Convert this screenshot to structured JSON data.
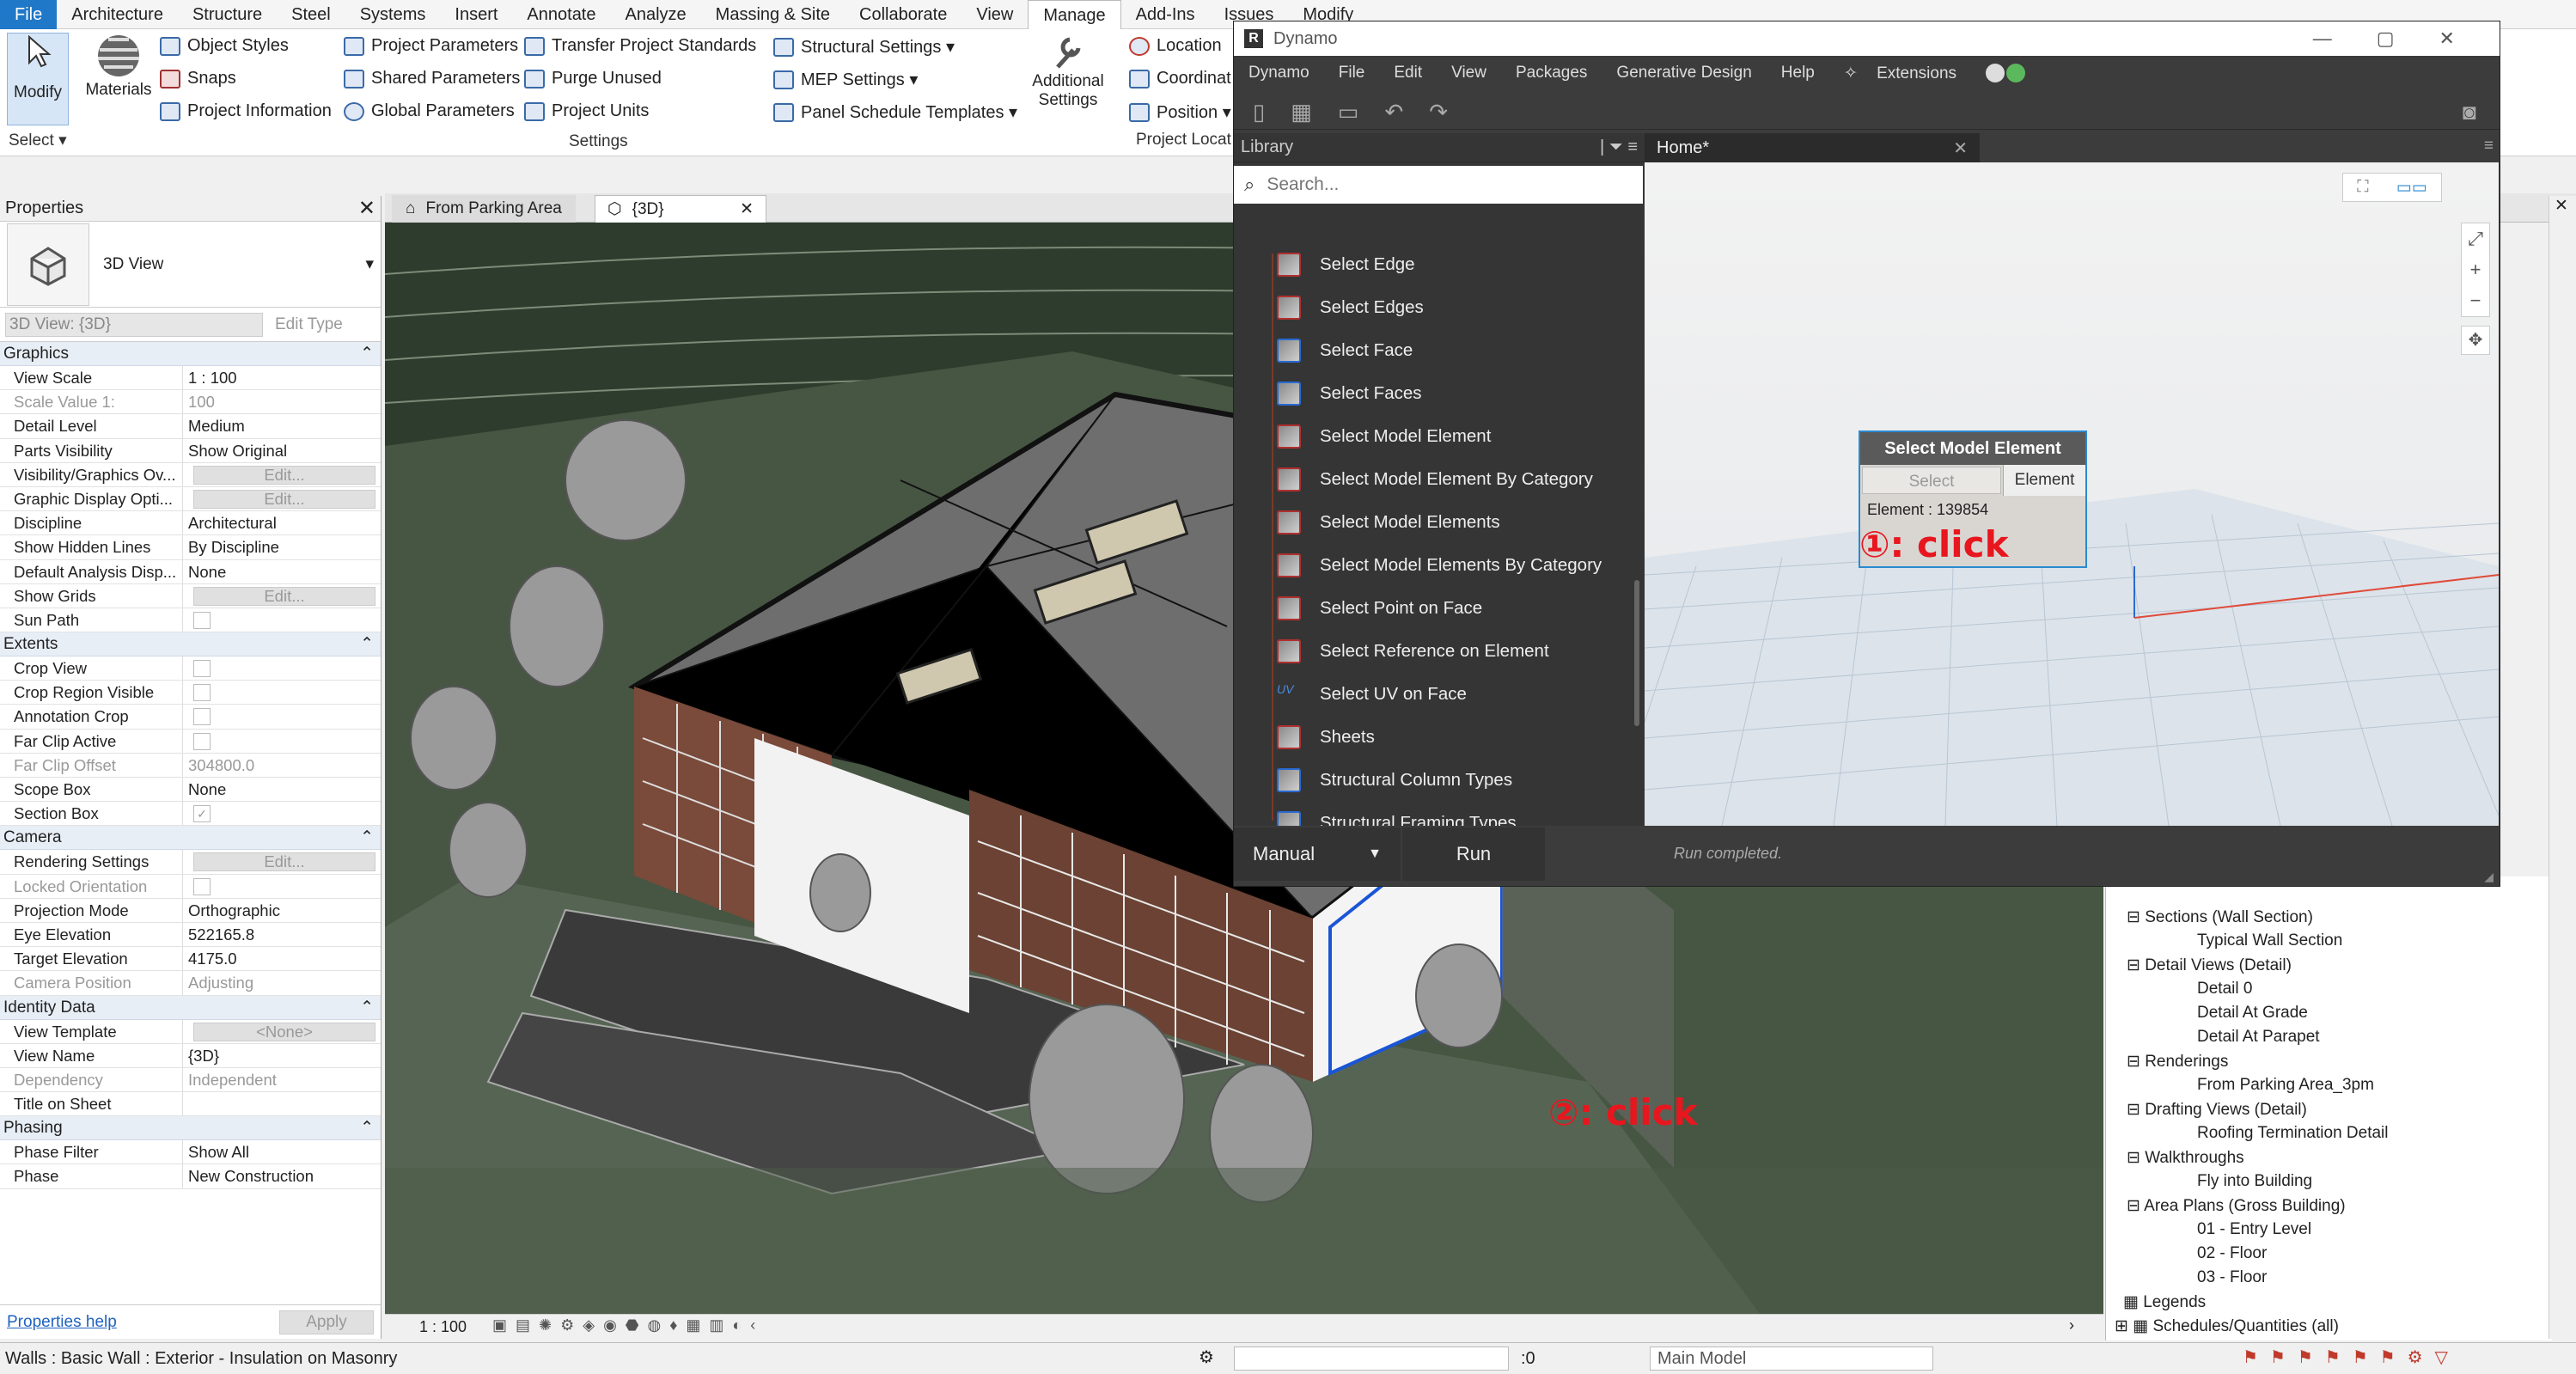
{
  "ribbon": {
    "tabs": [
      "File",
      "Architecture",
      "Structure",
      "Steel",
      "Systems",
      "Insert",
      "Annotate",
      "Analyze",
      "Massing & Site",
      "Collaborate",
      "View",
      "Manage",
      "Add-Ins",
      "Issues",
      "Modify"
    ],
    "active_tab": "Manage",
    "modify_label": "Modify",
    "select_label": "Select ▾",
    "materials_label": "Materials",
    "object_styles": "Object  Styles",
    "snaps": "Snaps",
    "project_information": "Project  Information",
    "project_parameters": "Project  Parameters",
    "shared_parameters": "Shared  Parameters",
    "global_parameters": "Global  Parameters",
    "transfer_project_standards": "Transfer  Project Standards",
    "purge_unused": "Purge  Unused",
    "project_units": "Project  Units",
    "settings_group": "Settings",
    "structural_settings": "Structural  Settings  ▾",
    "mep_settings": "MEP  Settings  ▾",
    "panel_schedule_templates": "Panel Schedule  Templates  ▾",
    "additional_settings_1": "Additional",
    "additional_settings_2": "Settings",
    "location": "Location",
    "coordinates": "Coordinat",
    "position": "Position  ▾",
    "project_location_group": "Project Locat"
  },
  "properties": {
    "title": "Properties",
    "type_name": "3D View",
    "instance_selector": "3D View: {3D}",
    "edit_type": "Edit Type",
    "sections": {
      "graphics": "Graphics",
      "extents": "Extents",
      "camera": "Camera",
      "identity": "Identity Data",
      "phasing": "Phasing"
    },
    "rows": {
      "view_scale": [
        "View Scale",
        "1 : 100"
      ],
      "scale_value": [
        "Scale Value    1:",
        "100"
      ],
      "detail_level": [
        "Detail Level",
        "Medium"
      ],
      "parts_visibility": [
        "Parts Visibility",
        "Show Original"
      ],
      "vg_overrides": [
        "Visibility/Graphics Ov...",
        "Edit..."
      ],
      "graphic_display": [
        "Graphic Display Opti...",
        "Edit..."
      ],
      "discipline": [
        "Discipline",
        "Architectural"
      ],
      "show_hidden_lines": [
        "Show Hidden Lines",
        "By Discipline"
      ],
      "default_analysis": [
        "Default Analysis Disp...",
        "None"
      ],
      "show_grids": [
        "Show Grids",
        "Edit..."
      ],
      "sun_path": [
        "Sun Path",
        ""
      ],
      "crop_view": [
        "Crop View",
        ""
      ],
      "crop_region_visible": [
        "Crop Region Visible",
        ""
      ],
      "annotation_crop": [
        "Annotation Crop",
        ""
      ],
      "far_clip_active": [
        "Far Clip Active",
        ""
      ],
      "far_clip_offset": [
        "Far Clip Offset",
        "304800.0"
      ],
      "scope_box": [
        "Scope Box",
        "None"
      ],
      "section_box": [
        "Section Box",
        ""
      ],
      "rendering_settings": [
        "Rendering Settings",
        "Edit..."
      ],
      "locked_orientation": [
        "Locked Orientation",
        ""
      ],
      "projection_mode": [
        "Projection Mode",
        "Orthographic"
      ],
      "eye_elevation": [
        "Eye Elevation",
        "522165.8"
      ],
      "target_elevation": [
        "Target Elevation",
        "4175.0"
      ],
      "camera_position": [
        "Camera Position",
        "Adjusting"
      ],
      "view_template": [
        "View Template",
        "<None>"
      ],
      "view_name": [
        "View Name",
        "{3D}"
      ],
      "dependency": [
        "Dependency",
        "Independent"
      ],
      "title_on_sheet": [
        "Title on Sheet",
        ""
      ],
      "phase_filter": [
        "Phase Filter",
        "Show All"
      ],
      "phase": [
        "Phase",
        "New Construction"
      ]
    },
    "help_link": "Properties help",
    "apply": "Apply"
  },
  "view_tabs": [
    "From Parking Area",
    "{3D}"
  ],
  "view_scale_bar": "1 : 100",
  "project_browser": {
    "items": [
      {
        "text": "Sections (Wall Section)",
        "level": 1
      },
      {
        "text": "Typical Wall Section",
        "level": 2
      },
      {
        "text": "Detail Views (Detail)",
        "level": 1
      },
      {
        "text": "Detail 0",
        "level": 2
      },
      {
        "text": "Detail At Grade",
        "level": 2
      },
      {
        "text": "Detail At Parapet",
        "level": 2
      },
      {
        "text": "Renderings",
        "level": 1
      },
      {
        "text": "From Parking Area_3pm",
        "level": 2
      },
      {
        "text": "Drafting Views (Detail)",
        "level": 1
      },
      {
        "text": "Roofing Termination Detail",
        "level": 2
      },
      {
        "text": "Walkthroughs",
        "level": 1
      },
      {
        "text": "Fly into Building",
        "level": 2
      },
      {
        "text": "Area Plans (Gross Building)",
        "level": 1
      },
      {
        "text": "01 - Entry Level",
        "level": 2
      },
      {
        "text": "02 - Floor",
        "level": 2
      },
      {
        "text": "03 - Floor",
        "level": 2
      },
      {
        "text": "Legends",
        "level": 0
      },
      {
        "text": "Schedules/Quantities (all)",
        "level": 0
      }
    ]
  },
  "status_bar": {
    "selection": "Walls : Basic Wall : Exterior - Insulation on Masonry",
    "count": ":0",
    "model": "Main Model"
  },
  "dynamo": {
    "window_title": "Dynamo",
    "menu": [
      "Dynamo",
      "File",
      "Edit",
      "View",
      "Packages",
      "Generative Design",
      "Help",
      "Extensions"
    ],
    "library_title": "Library",
    "search_placeholder": "Search...",
    "library_items": [
      "Select Edge",
      "Select Edges",
      "Select Face",
      "Select Faces",
      "Select Model Element",
      "Select Model Element By Category",
      "Select Model Elements",
      "Select Model Elements By Category",
      "Select Point on Face",
      "Select Reference on Element",
      "Select UV on Face",
      "Sheets",
      "Structural Column Types",
      "Structural Framing Types"
    ],
    "workspace_tab": "Home*",
    "node": {
      "title": "Select Model Element",
      "select_button": "Select",
      "output_port": "Element",
      "value": "Element : 139854"
    },
    "run_mode": "Manual",
    "run_button": "Run",
    "run_status": "Run completed."
  },
  "annotations": {
    "step1": "①: click",
    "step2": "②: click"
  },
  "colors": {
    "accent": "#1f78c8",
    "annotation": "#e8161e",
    "dynamo_bg": "#3c3c3c",
    "view_background": "#2d3d2c"
  }
}
